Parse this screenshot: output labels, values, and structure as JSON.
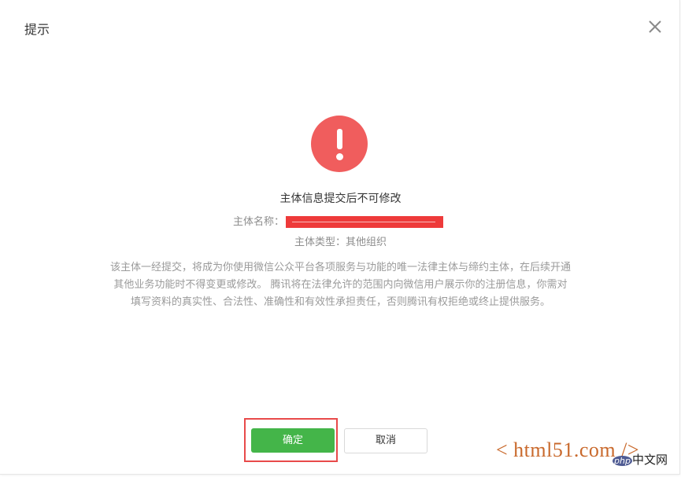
{
  "dialog": {
    "title": "提示",
    "close_icon": "close-icon",
    "alert_icon": "exclamation-circle-icon",
    "alert_color": "#f05d5d",
    "headline": "主体信息提交后不可修改",
    "entity_name_label": "主体名称：",
    "entity_type": "主体类型：其他组织",
    "description_lines": [
      "该主体一经提交，将成为你使用微信公众平台各项服务与功能的唯一法律主体与缔约主体，在后续开通",
      "其他业务功能时不得变更或修改。 腾讯将在法律允许的范围内向微信用户展示你的注册信息，你需对",
      "填写资料的真实性、合法性、准确性和有效性承担责任，否则腾讯有权拒绝或终止提供服务。"
    ],
    "confirm_label": "确定",
    "cancel_label": "取消",
    "confirm_color": "#44b549"
  },
  "watermark": {
    "site": "< html51.com />",
    "php_badge": "php",
    "cn_text": "中文网"
  }
}
